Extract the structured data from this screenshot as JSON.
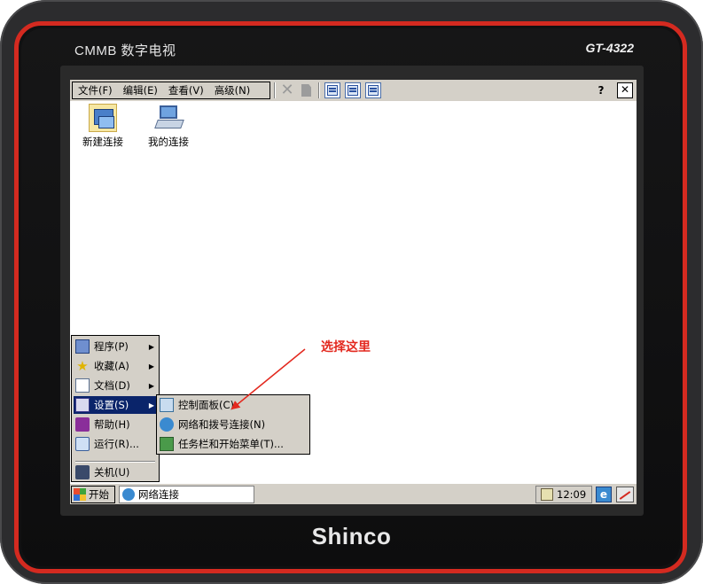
{
  "device": {
    "brand_left": "CMMB 数字电视",
    "model": "GT-4322",
    "logo": "Shinco"
  },
  "explorer": {
    "menu": [
      {
        "label": "文件(F)"
      },
      {
        "label": "编辑(E)"
      },
      {
        "label": "查看(V)"
      },
      {
        "label": "高级(N)"
      }
    ],
    "help_glyph": "?",
    "close_glyph": "✕",
    "icons": [
      {
        "label": "新建连接",
        "icon": "new-connection-icon"
      },
      {
        "label": "我的连接",
        "icon": "my-connection-icon"
      }
    ]
  },
  "start_menu": {
    "items": [
      {
        "label": "程序(P)",
        "icon": "programs-icon",
        "has_submenu": true
      },
      {
        "label": "收藏(A)",
        "icon": "favorites-icon",
        "has_submenu": true
      },
      {
        "label": "文档(D)",
        "icon": "documents-icon",
        "has_submenu": true
      },
      {
        "label": "设置(S)",
        "icon": "settings-icon",
        "has_submenu": true,
        "active": true
      },
      {
        "label": "帮助(H)",
        "icon": "help-icon"
      },
      {
        "label": "运行(R)...",
        "icon": "run-icon"
      },
      {
        "label": "关机(U)",
        "icon": "shutdown-icon"
      }
    ]
  },
  "settings_submenu": {
    "items": [
      {
        "label": "控制面板(C)",
        "icon": "control-panel-icon"
      },
      {
        "label": "网络和拨号连接(N)",
        "icon": "network-icon"
      },
      {
        "label": "任务栏和开始菜单(T)...",
        "icon": "taskbar-icon"
      }
    ]
  },
  "taskbar": {
    "start_label": "开始",
    "window_label": "网络连接",
    "clock": "12:09"
  },
  "annotation": {
    "text": "选择这里",
    "color": "#e3281e"
  },
  "colors": {
    "bezel": "#2c2c2e",
    "bezel_accent": "#d42a20",
    "menu_bg": "#d4d0c8",
    "highlight": "#0a246a"
  }
}
